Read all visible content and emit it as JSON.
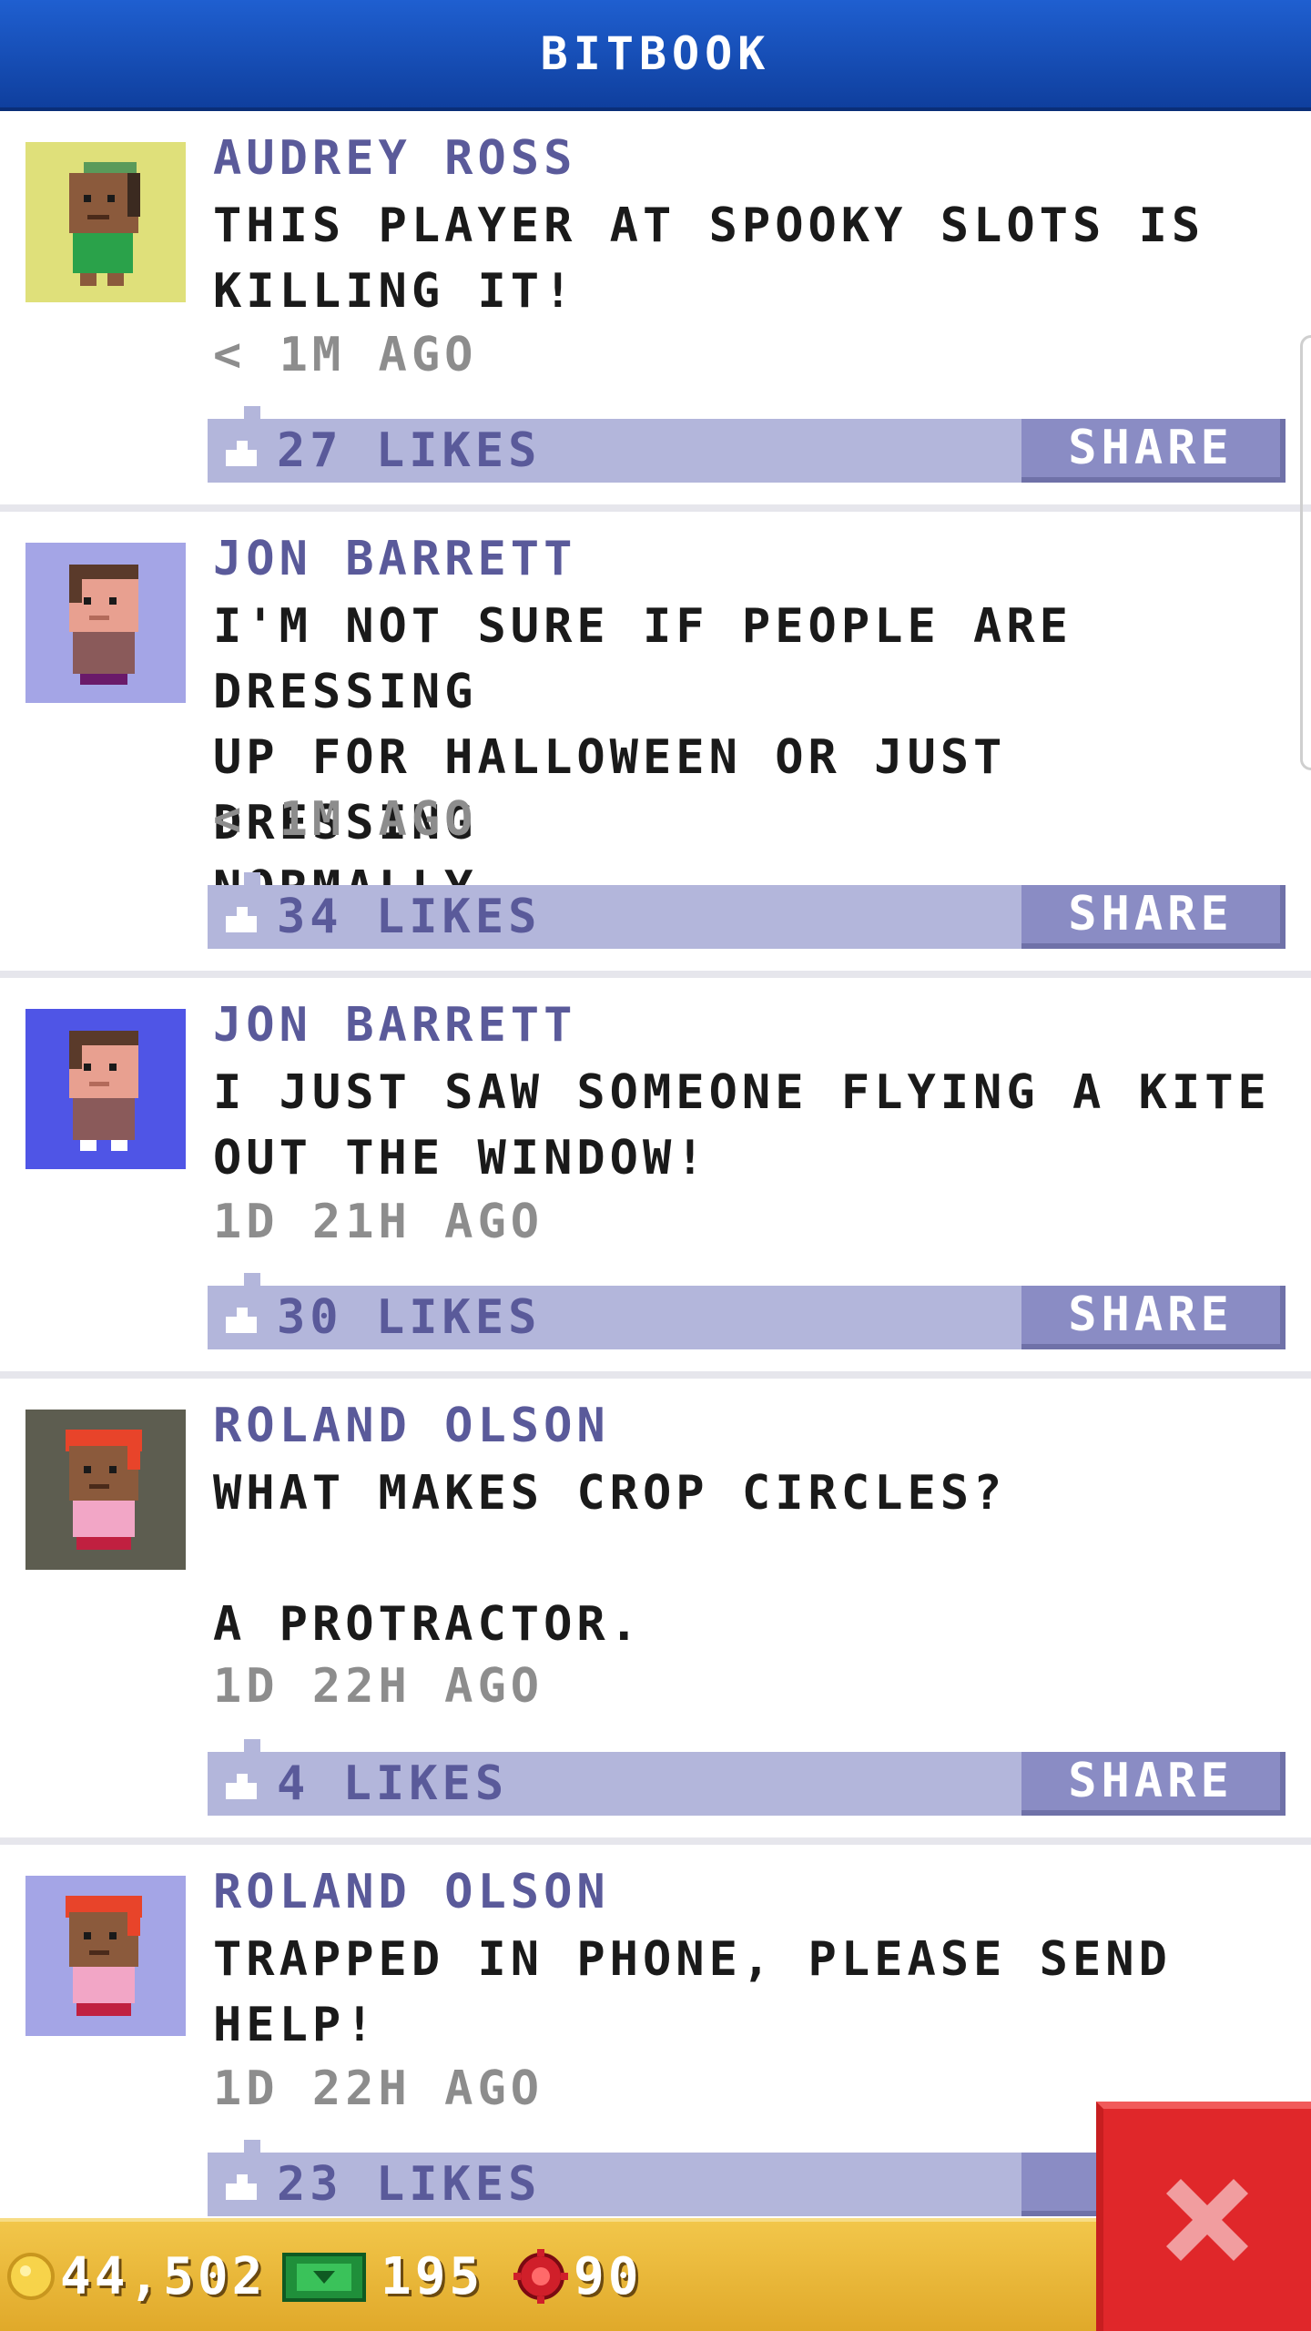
{
  "header": {
    "title": "BITBOOK"
  },
  "posts": [
    {
      "author": "AUDREY ROSS",
      "message": "THIS PLAYER AT SPOOKY SLOTS IS\nKILLING IT!",
      "time": "< 1M AGO",
      "likes": "27 LIKES",
      "share_label": "SHARE",
      "avatar_bg": "#dfe07a"
    },
    {
      "author": "JON BARRETT",
      "message": "I'M NOT SURE IF PEOPLE ARE DRESSING\nUP FOR HALLOWEEN OR JUST DRESSING\nNORMALLY...",
      "time": "< 1M AGO",
      "likes": "34 LIKES",
      "share_label": "SHARE",
      "avatar_bg": "#a4a5e6"
    },
    {
      "author": "JON BARRETT",
      "message": "I JUST SAW SOMEONE FLYING A KITE\nOUT THE WINDOW!",
      "time": "1D 21H AGO",
      "likes": "30 LIKES",
      "share_label": "SHARE",
      "avatar_bg": "#4f55e6"
    },
    {
      "author": "ROLAND OLSON",
      "message": "WHAT MAKES CROP CIRCLES?\n\nA PROTRACTOR.",
      "time": "1D 22H AGO",
      "likes": "4 LIKES",
      "share_label": "SHARE",
      "avatar_bg": "#5d5d50"
    },
    {
      "author": "ROLAND OLSON",
      "message": "TRAPPED IN PHONE, PLEASE SEND\nHELP!",
      "time": "1D 22H AGO",
      "likes": "23 LIKES",
      "share_label": "S",
      "avatar_bg": "#a4a5e6"
    }
  ],
  "footer": {
    "coins": "44,502",
    "bux": "195",
    "tokens": "90"
  },
  "icons": {
    "close": "close-icon",
    "coin": "coin-icon",
    "bux": "bux-icon",
    "token": "token-icon",
    "like": "thumbs-up-icon"
  },
  "colors": {
    "header": "#1f5fd0",
    "author": "#5a5a9a",
    "like_bar": "#b3b6db",
    "share_button": "#8a8cc4",
    "footer": "#f2c64a",
    "close": "#e0272a"
  }
}
